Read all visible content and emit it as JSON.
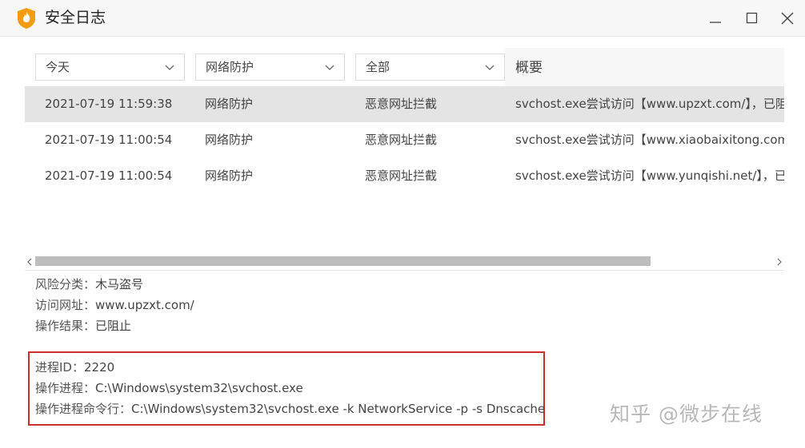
{
  "window": {
    "title": "安全日志",
    "icon": "shield-flame-icon",
    "controls": [
      "minimize-icon",
      "maximize-icon",
      "close-icon"
    ]
  },
  "filters": {
    "date": "今天",
    "type": "网络防护",
    "result": "全部",
    "summary_header": "概要"
  },
  "rows": [
    {
      "time": "2021-07-19 11:59:38",
      "type": "网络防护",
      "action": "恶意网址拦截",
      "summary": "svchost.exe尝试访问【www.upzxt.com/】，已阻"
    },
    {
      "time": "2021-07-19 11:00:54",
      "type": "网络防护",
      "action": "恶意网址拦截",
      "summary": "svchost.exe尝试访问【www.xiaobaixitong.com/"
    },
    {
      "time": "2021-07-19 11:00:54",
      "type": "网络防护",
      "action": "恶意网址拦截",
      "summary": "svchost.exe尝试访问【www.yunqishi.net/】，已"
    }
  ],
  "details": {
    "risk_label": "风险分类：",
    "risk_value": "木马盗号",
    "url_label": "访问网址：",
    "url_value": "www.upzxt.com/",
    "result_label": "操作结果：",
    "result_value": "已阻止",
    "pid_label": "进程ID：",
    "pid_value": "2220",
    "process_label": "操作进程：",
    "process_value": "C:\\Windows\\system32\\svchost.exe",
    "cmdline_label": "操作进程命令行：",
    "cmdline_value": "C:\\Windows\\system32\\svchost.exe -k NetworkService -p -s Dnscache"
  },
  "watermark": "知乎 @微步在线",
  "colors": {
    "selected_row": "#e4e4e4",
    "highlight_border": "#c9302c",
    "shield_orange": "#f39c12"
  }
}
